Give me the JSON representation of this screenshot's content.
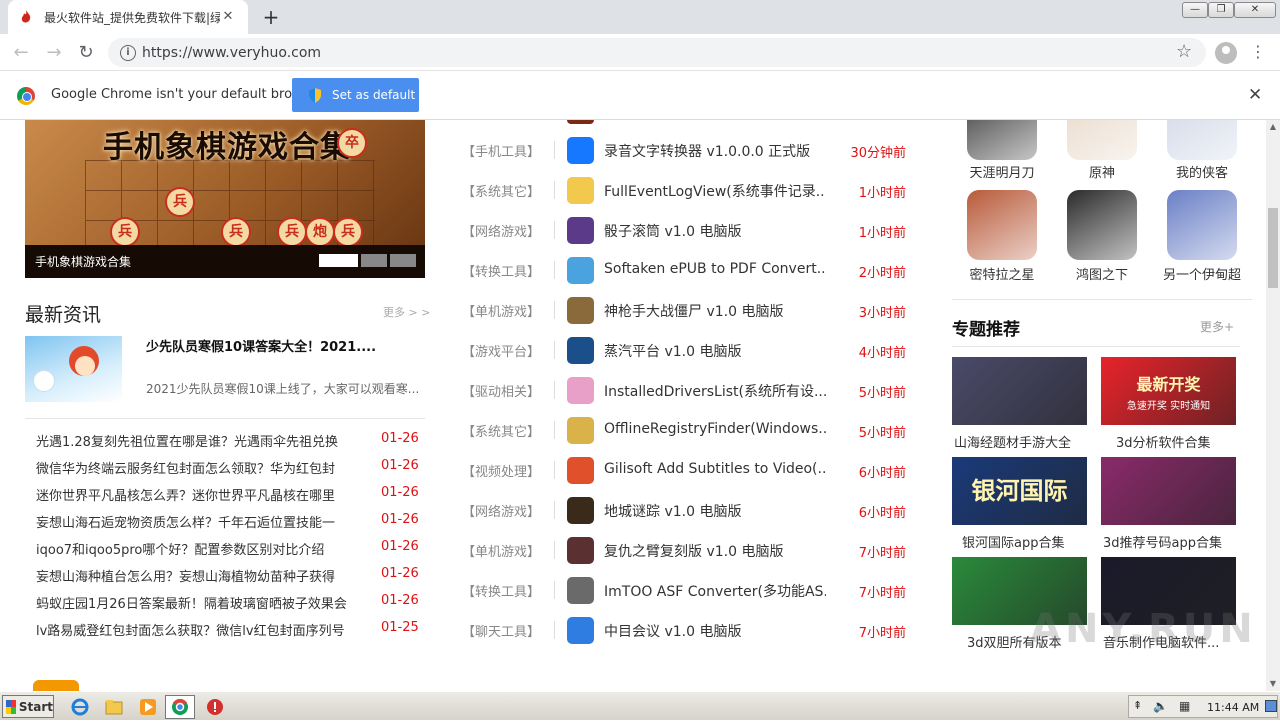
{
  "browser": {
    "tab_title": "最火软件站_提供免费软件下载|绿色",
    "tab_close": "✕",
    "new_tab": "+",
    "url": "https://www.veryhuo.com",
    "window_controls": [
      "—",
      "❐",
      "✕"
    ]
  },
  "infobar": {
    "message": "Google Chrome isn't your default browser",
    "button": "Set as default",
    "close": "✕"
  },
  "banner": {
    "headline": "手机象棋游戏合集",
    "caption": "手机象棋游戏合集",
    "pieces": [
      "兵",
      "兵",
      "兵",
      "兵",
      "炮",
      "兵",
      "卒"
    ]
  },
  "news": {
    "title": "最新资讯",
    "more": "更多 > >",
    "featured_title": "少先队员寒假10课答案大全！2021....",
    "featured_desc": "2021少先队员寒假10课上线了，大家可以观看寒...",
    "items": [
      {
        "title": "光遇1.28复刻先祖位置在哪是谁？光遇雨伞先祖兑换",
        "date": "01-26"
      },
      {
        "title": "微信华为终端云服务红包封面怎么领取？华为红包封",
        "date": "01-26"
      },
      {
        "title": "迷你世界平凡晶核怎么弄？迷你世界平凡晶核在哪里",
        "date": "01-26"
      },
      {
        "title": "妄想山海石逅宠物资质怎么样？千年石逅位置技能一",
        "date": "01-26"
      },
      {
        "title": "iqoo7和iqoo5pro哪个好？配置参数区别对比介绍",
        "date": "01-26"
      },
      {
        "title": "妄想山海种植台怎么用？妄想山海植物幼苗种子获得",
        "date": "01-26"
      },
      {
        "title": "蚂蚁庄园1月26日答案最新！隔着玻璃窗晒被子效果会",
        "date": "01-26"
      },
      {
        "title": "lv路易威登红包封面怎么获取？微信lv红包封面序列号",
        "date": "01-25"
      }
    ]
  },
  "software": [
    {
      "cat": "【手机工具】",
      "name": "录音文字转换器 v1.0.0.0 正式版",
      "time": "30分钟前",
      "color": "#1677ff"
    },
    {
      "cat": "【系统其它】",
      "name": "FullEventLogView(系统事件记录...",
      "time": "1小时前",
      "color": "#f2c94c"
    },
    {
      "cat": "【网络游戏】",
      "name": "骰子滚筒 v1.0 电脑版",
      "time": "1小时前",
      "color": "#5b3a8a"
    },
    {
      "cat": "【转换工具】",
      "name": "Softaken ePUB to PDF Convert...",
      "time": "2小时前",
      "color": "#4aa3df"
    },
    {
      "cat": "【单机游戏】",
      "name": "神枪手大战僵尸 v1.0 电脑版",
      "time": "3小时前",
      "color": "#8a6a3a"
    },
    {
      "cat": "【游戏平台】",
      "name": "蒸汽平台 v1.0 电脑版",
      "time": "4小时前",
      "color": "#1b4f8a"
    },
    {
      "cat": "【驱动相关】",
      "name": "InstalledDriversList(系统所有设...",
      "time": "5小时前",
      "color": "#e8a0c8"
    },
    {
      "cat": "【系统其它】",
      "name": "OfflineRegistryFinder(Windows...",
      "time": "5小时前",
      "color": "#d9b24a"
    },
    {
      "cat": "【视频处理】",
      "name": "Gilisoft Add Subtitles to Video(...",
      "time": "6小时前",
      "color": "#e0502a"
    },
    {
      "cat": "【网络游戏】",
      "name": "地城谜踪 v1.0 电脑版",
      "time": "6小时前",
      "color": "#3a2a1a"
    },
    {
      "cat": "【单机游戏】",
      "name": "复仇之臂复刻版 v1.0 电脑版",
      "time": "7小时前",
      "color": "#5a3030"
    },
    {
      "cat": "【转换工具】",
      "name": "ImTOO ASF Converter(多功能AS...",
      "time": "7小时前",
      "color": "#6a6a6a"
    },
    {
      "cat": "【聊天工具】",
      "name": "中目会议 v1.0 电脑版",
      "time": "7小时前",
      "color": "#2f7de1"
    }
  ],
  "games": [
    {
      "label": "天涯明月刀",
      "color": "#3a3a3a"
    },
    {
      "label": "原神",
      "color": "#e8d8c8"
    },
    {
      "label": "我的侠客",
      "color": "#cfd6e6"
    },
    {
      "label": "密特拉之星",
      "color": "#b85a3a"
    },
    {
      "label": "鸿图之下",
      "color": "#2a2a2a"
    },
    {
      "label": "另一个伊甸超",
      "color": "#6a7fc6"
    }
  ],
  "topics": {
    "title": "专题推荐",
    "more": "更多+",
    "items": [
      {
        "label": "山海经题材手游大全",
        "color": "#4a4a6a"
      },
      {
        "label": "3d分析软件合集",
        "color": "#e8232a",
        "banner": "最新开奖",
        "sub": "急速开奖 实时通知"
      },
      {
        "label": "银河国际app合集",
        "color": "#1a3a7a",
        "banner": "银河国际"
      },
      {
        "label": "3d推荐号码app合集",
        "color": "#8a2a6a"
      },
      {
        "label": "3d双胆所有版本",
        "color": "#2a8a3a"
      },
      {
        "label": "音乐制作电脑软件...",
        "color": "#1a1a2a"
      }
    ]
  },
  "watermark": "ANY.RUN",
  "taskbar": {
    "start": "Start",
    "clock": "11:44 AM"
  }
}
